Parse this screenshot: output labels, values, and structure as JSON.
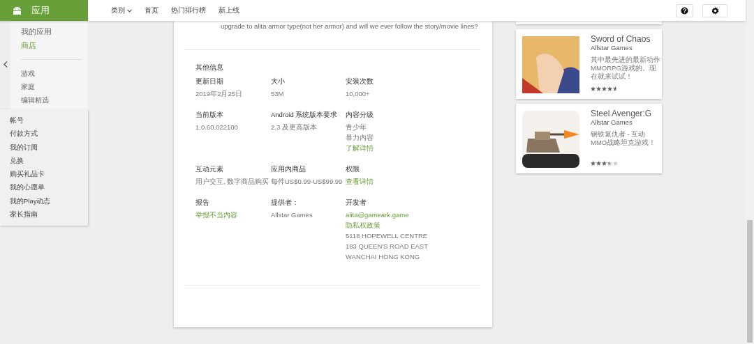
{
  "brand": {
    "title": "应用"
  },
  "nav": [
    {
      "label": "类别",
      "dropdown": true
    },
    {
      "label": "首页",
      "dropdown": false
    },
    {
      "label": "热门排行榜",
      "dropdown": false
    },
    {
      "label": "新上线",
      "dropdown": false
    }
  ],
  "sidebar": {
    "items": [
      {
        "label": "我的应用",
        "selected": false
      },
      {
        "label": "商店",
        "selected": true
      }
    ],
    "categories": [
      "游戏",
      "家庭",
      "编辑精选"
    ],
    "account": [
      "帐号",
      "付款方式",
      "我的订阅",
      "兑换",
      "购买礼品卡",
      "我的心愿单",
      "我的Play动态",
      "家长指南"
    ]
  },
  "review": {
    "text": "upgrade to alita armor type(not her armor) and will we ever follow the story/movie lines?"
  },
  "info": {
    "title": "其他信息",
    "fields": [
      {
        "label": "更新日期",
        "values": [
          {
            "text": "2019年2月25日",
            "kind": "text"
          }
        ]
      },
      {
        "label": "大小",
        "values": [
          {
            "text": "53M",
            "kind": "text"
          }
        ]
      },
      {
        "label": "安装次数",
        "values": [
          {
            "text": "10,000+",
            "kind": "text"
          }
        ]
      },
      {
        "label": "当前版本",
        "values": [
          {
            "text": "1.0.60.022100",
            "kind": "text"
          }
        ]
      },
      {
        "label": "Android 系统版本要求",
        "values": [
          {
            "text": "2.3 及更高版本",
            "kind": "text"
          }
        ]
      },
      {
        "label": "内容分级",
        "values": [
          {
            "text": "青少年",
            "kind": "text"
          },
          {
            "text": "暴力内容",
            "kind": "text"
          },
          {
            "text": "了解详情",
            "kind": "link"
          }
        ]
      },
      {
        "label": "互动元素",
        "values": [
          {
            "text": "用户交互, 数字商品购买",
            "kind": "text"
          }
        ]
      },
      {
        "label": "应用内商品",
        "values": [
          {
            "text": "每件US$0.99-US$99.99",
            "kind": "text"
          }
        ]
      },
      {
        "label": "权限",
        "values": [
          {
            "text": "查看详情",
            "kind": "link"
          }
        ]
      },
      {
        "label": "报告",
        "values": [
          {
            "text": "举报不当内容",
            "kind": "link"
          }
        ]
      },
      {
        "label": "提供者：",
        "values": [
          {
            "text": "Allstar Games",
            "kind": "text"
          }
        ]
      },
      {
        "label": "开发者",
        "values": [
          {
            "text": "alita@gameark.game",
            "kind": "link"
          },
          {
            "text": "隐私权政策",
            "kind": "link"
          },
          {
            "text": "5118 HOPEWELL CENTRE 183 QUEEN'S ROAD EAST WANCHAI HONG KONG",
            "kind": "text"
          }
        ]
      }
    ]
  },
  "similar": [
    {
      "title": "Sword of Chaos",
      "developer": "Allstar Games",
      "description": "其中最先进的最新动作MMORPG游戏的。现在就来试试！",
      "stars": 4.5,
      "kind": "fantasy"
    },
    {
      "title": "Steel Avenger:G",
      "developer": "Allstar Games",
      "description": "钢铁复仇者 - 互动MMO战略坦克游戏！",
      "stars": 3.5,
      "kind": "tank"
    }
  ]
}
